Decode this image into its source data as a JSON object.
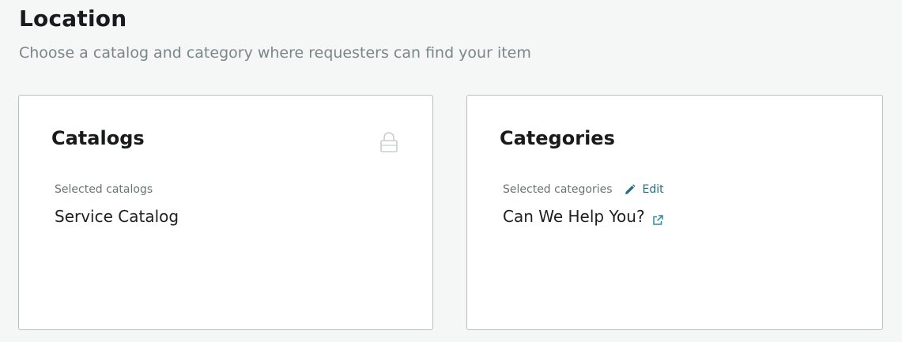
{
  "header": {
    "title": "Location",
    "subtitle": "Choose a catalog and category where requesters can find your item"
  },
  "catalogs": {
    "title": "Catalogs",
    "label": "Selected catalogs",
    "value": "Service Catalog",
    "icon": "lock-icon"
  },
  "categories": {
    "title": "Categories",
    "label": "Selected categories",
    "edit_label": "Edit",
    "value": "Can We Help You?",
    "edit_icon": "pencil-icon",
    "link_icon": "external-link-icon"
  },
  "colors": {
    "accent": "#1f6f86",
    "muted_text": "#7a8689",
    "border": "#b9bfc1",
    "background": "#f5f6f6"
  }
}
